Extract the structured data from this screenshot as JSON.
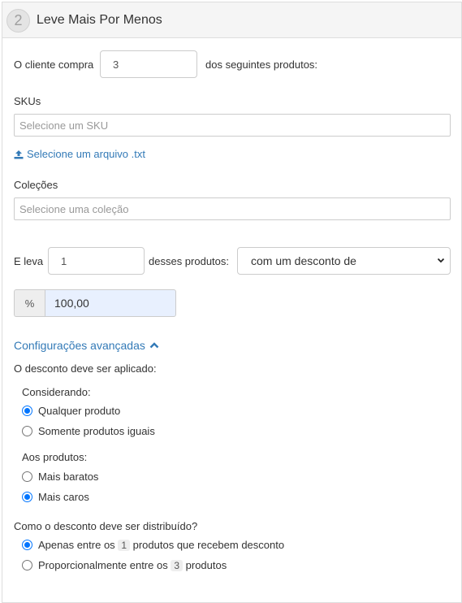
{
  "header": {
    "step": "2",
    "title": "Leve Mais Por Menos"
  },
  "buy": {
    "prefix": "O cliente compra",
    "quantity": "3",
    "suffix": "dos seguintes produtos:"
  },
  "skus": {
    "label": "SKUs",
    "placeholder": "Selecione um SKU",
    "upload_link": "Selecione um arquivo .txt"
  },
  "collections": {
    "label": "Coleções",
    "placeholder": "Selecione uma coleção"
  },
  "take": {
    "prefix": "E leva",
    "quantity": "1",
    "suffix": "desses produtos:",
    "select_value": "com um desconto de"
  },
  "discount": {
    "addon": "%",
    "value": "100,00"
  },
  "advanced": {
    "toggle_label": "Configurações avançadas",
    "apply_title": "O desconto deve ser aplicado:",
    "considering": {
      "label": "Considerando:",
      "options": [
        "Qualquer produto",
        "Somente produtos iguais"
      ],
      "selected": 0
    },
    "products": {
      "label": "Aos produtos:",
      "options": [
        "Mais baratos",
        "Mais caros"
      ],
      "selected": 1
    },
    "distribution": {
      "label": "Como o desconto deve ser distribuído?",
      "option1": {
        "before": "Apenas entre os",
        "count": "1",
        "after": "produtos que recebem desconto"
      },
      "option2": {
        "before": "Proporcionalmente entre os",
        "count": "3",
        "after": "produtos"
      },
      "selected": 0
    }
  },
  "colors": {
    "link": "#337ab7",
    "radio": "#0075ff",
    "autofill": "#e8f0fe"
  }
}
